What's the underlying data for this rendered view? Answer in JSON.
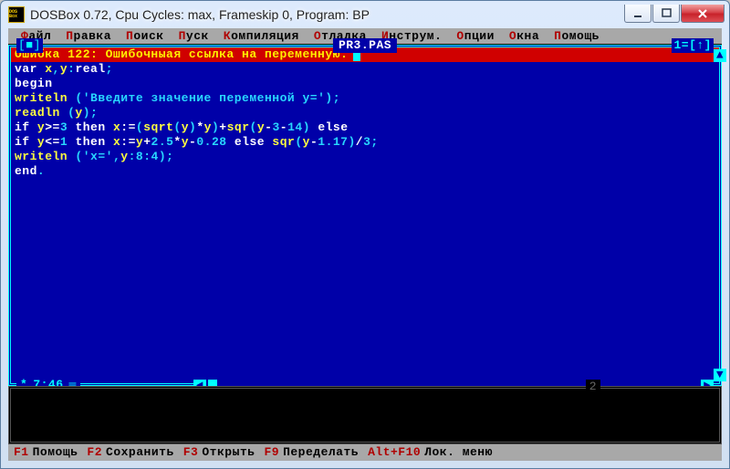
{
  "window": {
    "title": "DOSBox 0.72, Cpu Cycles:      max, Frameskip  0, Program:      BP",
    "icon_text": "DOS\nBox"
  },
  "menubar": {
    "items": [
      "Файл",
      "Правка",
      "Поиск",
      "Пуск",
      "Компиляция",
      "Отладка",
      "Инструм.",
      "Опции",
      "Окна",
      "Помощь"
    ]
  },
  "editor": {
    "filename": "PR3.PAS",
    "window_number": "1",
    "close_gadget": "[■]",
    "right_gadget": "=[↑]",
    "error": "Ошибка 122: Ошибочныая ссылка на переменную.",
    "cursor_pos": "7:46",
    "modified_star": "*",
    "code_lines": [
      {
        "raw": "var x,y:real;",
        "tokens": [
          [
            "kw",
            "var"
          ],
          [
            "",
            " x"
          ],
          [
            "punct",
            ","
          ],
          [
            "",
            "y"
          ],
          [
            "punct",
            ":"
          ],
          [
            "kw",
            "real"
          ],
          [
            "punct",
            ";"
          ]
        ]
      },
      {
        "raw": "begin",
        "tokens": [
          [
            "kw",
            "begin"
          ]
        ]
      },
      {
        "raw": "writeln ('Введите значение переменной y=');",
        "tokens": [
          [
            "",
            "writeln "
          ],
          [
            "punct",
            "("
          ],
          [
            "str",
            "'Введите значение переменной y='"
          ],
          [
            "punct",
            ")"
          ],
          [
            "punct",
            ";"
          ]
        ]
      },
      {
        "raw": "readln (y);",
        "tokens": [
          [
            "",
            "readln "
          ],
          [
            "punct",
            "("
          ],
          [
            "",
            "y"
          ],
          [
            "punct",
            ")"
          ],
          [
            "punct",
            ";"
          ]
        ]
      },
      {
        "raw": "if y>=3 then x:=(sqrt(y)*y)+sqr(y-3-14) else",
        "tokens": [
          [
            "kw",
            "if"
          ],
          [
            "",
            " y"
          ],
          [
            "op",
            ">="
          ],
          [
            "num",
            "3"
          ],
          [
            "",
            " "
          ],
          [
            "kw",
            "then"
          ],
          [
            "",
            " x"
          ],
          [
            "op",
            ":="
          ],
          [
            "punct",
            "("
          ],
          [
            "",
            "sqrt"
          ],
          [
            "punct",
            "("
          ],
          [
            "",
            "y"
          ],
          [
            "punct",
            ")"
          ],
          [
            "op",
            "*"
          ],
          [
            "",
            "y"
          ],
          [
            "punct",
            ")"
          ],
          [
            "op",
            "+"
          ],
          [
            "",
            "sqr"
          ],
          [
            "punct",
            "("
          ],
          [
            "",
            "y"
          ],
          [
            "op",
            "-"
          ],
          [
            "num",
            "3"
          ],
          [
            "op",
            "-"
          ],
          [
            "num",
            "14"
          ],
          [
            "punct",
            ")"
          ],
          [
            "",
            " "
          ],
          [
            "kw",
            "else"
          ]
        ]
      },
      {
        "raw": "if y<=1 then x:=y+2.5*y-0.28 else sqr(y-1.17)/3;",
        "tokens": [
          [
            "kw",
            "if"
          ],
          [
            "",
            " y"
          ],
          [
            "op",
            "<="
          ],
          [
            "num",
            "1"
          ],
          [
            "",
            " "
          ],
          [
            "kw",
            "then"
          ],
          [
            "",
            " x"
          ],
          [
            "op",
            ":="
          ],
          [
            "",
            "y"
          ],
          [
            "op",
            "+"
          ],
          [
            "num",
            "2.5"
          ],
          [
            "op",
            "*"
          ],
          [
            "",
            "y"
          ],
          [
            "op",
            "-"
          ],
          [
            "num",
            "0.28"
          ],
          [
            "",
            " "
          ],
          [
            "kw",
            "else"
          ],
          [
            "",
            " sqr"
          ],
          [
            "punct",
            "("
          ],
          [
            "",
            "y"
          ],
          [
            "op",
            "-"
          ],
          [
            "num",
            "1.17"
          ],
          [
            "punct",
            ")"
          ],
          [
            "op",
            "/"
          ],
          [
            "num",
            "3"
          ],
          [
            "punct",
            ";"
          ]
        ]
      },
      {
        "raw": "writeln ('x=',y:8:4);",
        "tokens": [
          [
            "",
            "writeln "
          ],
          [
            "punct",
            "("
          ],
          [
            "str",
            "'x='"
          ],
          [
            "punct",
            ","
          ],
          [
            "",
            "y"
          ],
          [
            "punct",
            ":"
          ],
          [
            "num",
            "8"
          ],
          [
            "punct",
            ":"
          ],
          [
            "num",
            "4"
          ],
          [
            "punct",
            ")"
          ],
          [
            "punct",
            ";"
          ]
        ]
      },
      {
        "raw": "end.",
        "tokens": [
          [
            "kw",
            "end"
          ],
          [
            "punct",
            "."
          ]
        ]
      }
    ]
  },
  "output_panel": {
    "marker": "2"
  },
  "hints": [
    {
      "key": "F1",
      "label": "Помощь"
    },
    {
      "key": "F2",
      "label": "Сохранить"
    },
    {
      "key": "F3",
      "label": "Открыть"
    },
    {
      "key": "F9",
      "label": "Переделать"
    },
    {
      "key": "Alt+F10",
      "label": "Лок. меню"
    }
  ]
}
